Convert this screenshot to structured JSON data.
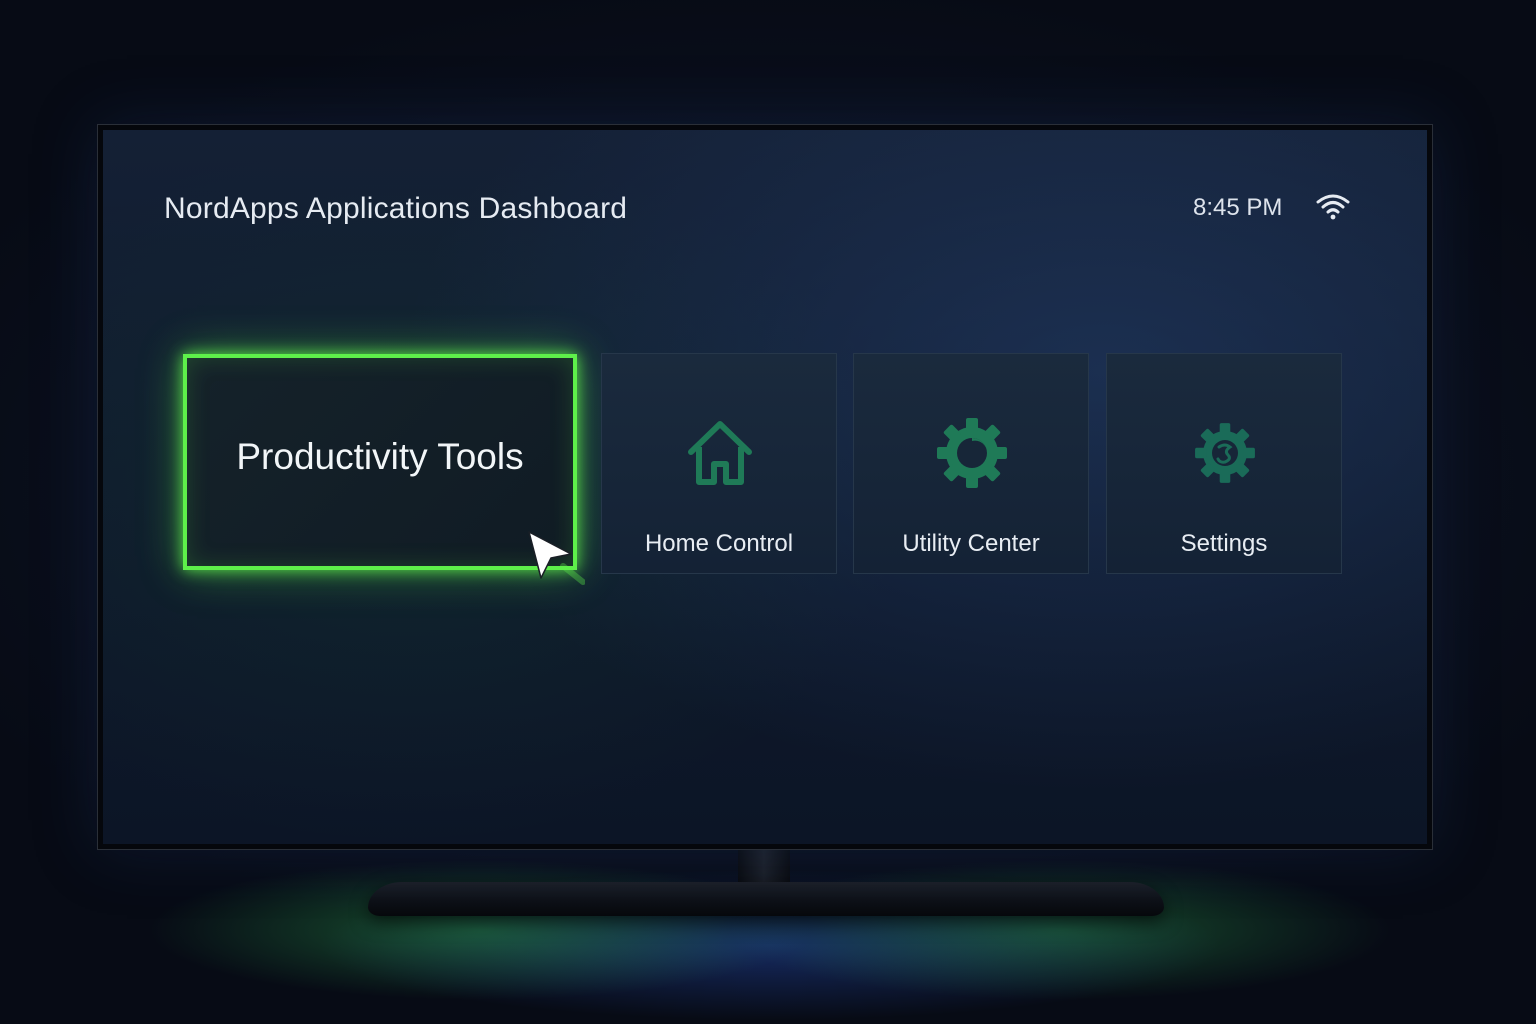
{
  "header": {
    "title": "NordApps Applications Dashboard",
    "time": "8:45 PM",
    "wifi_icon": "wifi-icon"
  },
  "tiles": [
    {
      "label": "Productivity Tools",
      "icon": "",
      "focused": true
    },
    {
      "label": "Home Control",
      "icon": "house-icon",
      "focused": false
    },
    {
      "label": "Utility Center",
      "icon": "gear-icon",
      "focused": false
    },
    {
      "label": "Settings",
      "icon": "settings-gear-icon",
      "focused": false
    }
  ],
  "colors": {
    "focus_border": "#5ef04a",
    "icon_green": "#1f7a57",
    "text": "#e8edf3",
    "screen_bg": "#111c2f"
  }
}
